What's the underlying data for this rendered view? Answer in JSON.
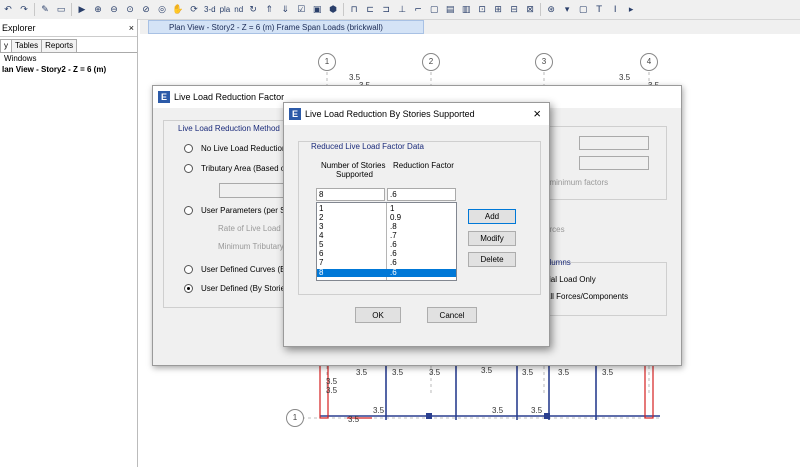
{
  "toolbar": {
    "view3d": "3-d",
    "pla": "pla",
    "nd": "nd"
  },
  "explorer": {
    "title": "Explorer",
    "close": "×",
    "tabs": [
      "y",
      "Tables",
      "Reports"
    ],
    "tree": [
      "Windows",
      "lan View - Story2 - Z = 6 (m)"
    ]
  },
  "document_tab": "Plan View - Story2 - Z = 6 (m)  Frame Span Loads (brickwall)",
  "plan": {
    "grid_labels": [
      "1",
      "2",
      "3",
      "4",
      "1"
    ],
    "dims": [
      "3.5",
      "3.5",
      "3.5",
      "3.5",
      "3.5",
      "3.5",
      "3.5",
      "3.5",
      "3.5",
      "3.5",
      "3.5",
      "3.5",
      "3.5",
      "3.5",
      "3.5",
      "3.5",
      "3.5"
    ]
  },
  "llrf": {
    "title": "Live Load Reduction Factor",
    "group": "Live Load Reduction Method",
    "options": [
      {
        "label": "No Live Load Reduction",
        "selected": false
      },
      {
        "label": "Tributary Area (Based on",
        "selected": false
      },
      {
        "label": "User Parameters (per Se",
        "selected": false
      },
      {
        "label": "User Defined Curves (By",
        "selected": false
      },
      {
        "label": "User Defined (By Stories",
        "selected": true
      }
    ],
    "sub_rate": "Rate of Live Load",
    "sub_min": "Minimum Tributary",
    "right_frag_1": "s",
    "right_frag_2": "t minimum factors",
    "right_frag_3": "orces",
    "right_group": "olumns",
    "right_opt_1": "xial Load Only",
    "right_opt_2": "All Forces/Components"
  },
  "stories_dialog": {
    "title": "Live Load Reduction By Stories Supported",
    "close": "×",
    "group": "Reduced Live Load Factor Data",
    "col1": "Number of Stories",
    "col1b": "Supported",
    "col2": "Reduction   Factor",
    "edit_stories": "8",
    "edit_factor": ".6",
    "rows": [
      {
        "stories": "1",
        "factor": "1"
      },
      {
        "stories": "2",
        "factor": "0.9"
      },
      {
        "stories": "3",
        "factor": ".8"
      },
      {
        "stories": "4",
        "factor": ".7"
      },
      {
        "stories": "5",
        "factor": ".6"
      },
      {
        "stories": "6",
        "factor": ".6"
      },
      {
        "stories": "7",
        "factor": ".6"
      },
      {
        "stories": "8",
        "factor": ".6"
      }
    ],
    "selected_index": 7,
    "add": "Add",
    "modify": "Modify",
    "delete": "Delete",
    "ok": "OK",
    "cancel": "Cancel"
  },
  "colors": {
    "accent": "#0078d7",
    "frame_red": "#d42020",
    "frame_blue": "#2a3f8f"
  }
}
